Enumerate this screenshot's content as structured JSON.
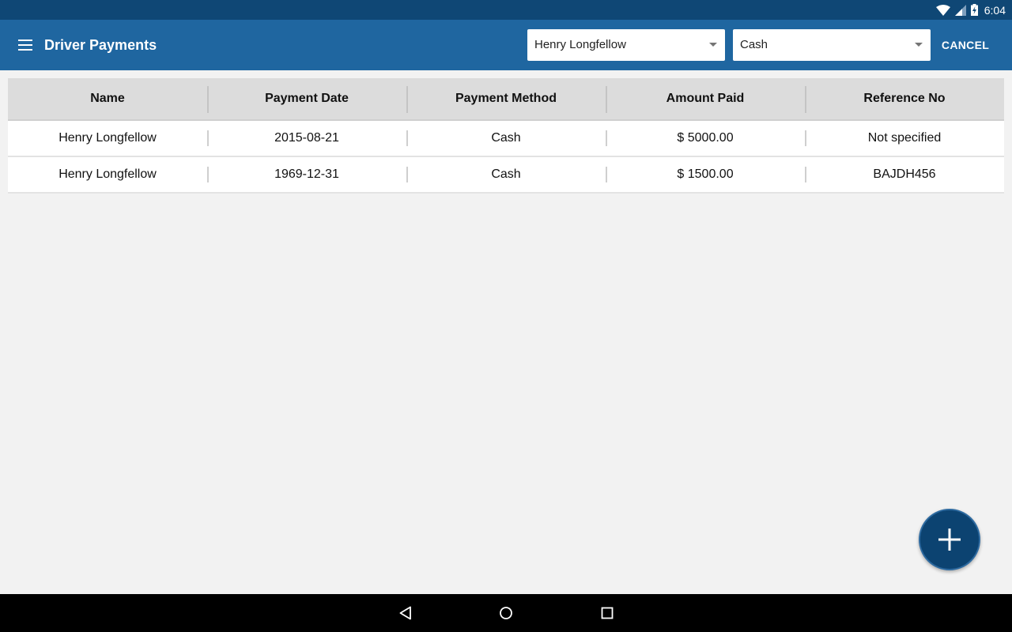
{
  "status_bar": {
    "time": "6:04",
    "icons": [
      "wifi-icon",
      "signal-icon",
      "battery-charging-icon"
    ]
  },
  "app_bar": {
    "title": "Driver Payments",
    "menu_icon": "hamburger-menu-icon",
    "driver_select": {
      "value": "Henry Longfellow"
    },
    "method_select": {
      "value": "Cash"
    },
    "cancel_label": "CANCEL"
  },
  "table": {
    "columns": [
      "Name",
      "Payment Date",
      "Payment Method",
      "Amount Paid",
      "Reference No"
    ],
    "rows": [
      [
        "Henry Longfellow",
        "2015-08-21",
        "Cash",
        "$ 5000.00",
        "Not specified"
      ],
      [
        "Henry Longfellow",
        "1969-12-31",
        "Cash",
        "$ 1500.00",
        "BAJDH456"
      ]
    ]
  },
  "fab": {
    "icon": "plus-icon"
  },
  "nav_bar": {
    "icons": [
      "back-icon",
      "home-icon",
      "recents-icon"
    ]
  },
  "colors": {
    "status_bar": "#0f4775",
    "app_bar": "#1f66a0",
    "fab": "#0c4371",
    "table_header": "#dcdcdc",
    "background": "#f2f2f2"
  }
}
